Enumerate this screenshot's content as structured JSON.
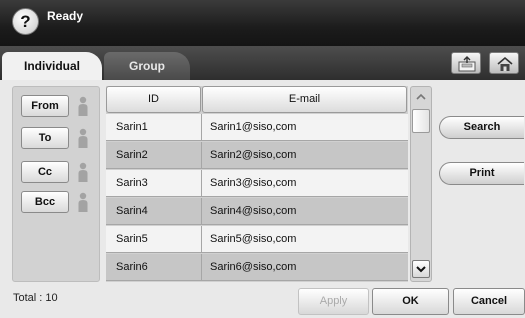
{
  "status": {
    "text": "Ready",
    "help_icon": "?"
  },
  "tabs": [
    {
      "label": "Individual",
      "active": true
    },
    {
      "label": "Group",
      "active": false
    }
  ],
  "toolbar": {
    "export_icon": "export-tray-icon",
    "home_icon": "home-icon"
  },
  "recipients": {
    "buttons": [
      "From",
      "To",
      "Cc",
      "Bcc"
    ],
    "icon": "person-icon"
  },
  "table": {
    "headers": {
      "id": "ID",
      "email": "E-mail"
    },
    "rows": [
      {
        "id": "Sarin1",
        "email": "Sarin1@siso,com"
      },
      {
        "id": "Sarin2",
        "email": "Sarin2@siso,com"
      },
      {
        "id": "Sarin3",
        "email": "Sarin3@siso,com"
      },
      {
        "id": "Sarin4",
        "email": "Sarin4@siso,com"
      },
      {
        "id": "Sarin5",
        "email": "Sarin5@siso,com"
      },
      {
        "id": "Sarin6",
        "email": "Sarin6@siso,com"
      }
    ]
  },
  "scrollbar": {
    "up_icon": "chevron-up-icon",
    "down_icon": "chevron-down-icon"
  },
  "actions": {
    "search": "Search",
    "print": "Print"
  },
  "footer": {
    "total": "Total : 10",
    "apply": "Apply",
    "ok": "OK",
    "cancel": "Cancel"
  },
  "colors": {
    "status_bar": "#1c1c1c",
    "row_light": "#f3f3f3",
    "row_dark": "#c6c6c6",
    "disabled_text": "#aaaaaa"
  }
}
